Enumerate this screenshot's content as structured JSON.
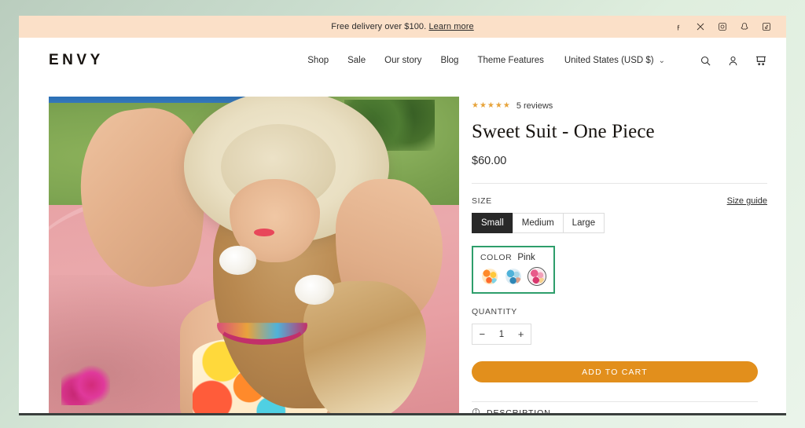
{
  "announcement": {
    "text": "Free delivery over $100.",
    "link_label": "Learn more",
    "socials": [
      {
        "name": "facebook-icon",
        "label": "Facebook"
      },
      {
        "name": "x-twitter-icon",
        "label": "X"
      },
      {
        "name": "instagram-icon",
        "label": "Instagram"
      },
      {
        "name": "snapchat-icon",
        "label": "Snapchat"
      },
      {
        "name": "tiktok-icon",
        "label": "TikTok"
      }
    ]
  },
  "header": {
    "logo": "ENVY",
    "nav": [
      {
        "label": "Shop"
      },
      {
        "label": "Sale"
      },
      {
        "label": "Our story"
      },
      {
        "label": "Blog"
      },
      {
        "label": "Theme Features"
      }
    ],
    "locale": "United States (USD $)",
    "locale_caret": "⌄",
    "icons": [
      {
        "name": "search-icon"
      },
      {
        "name": "account-icon"
      },
      {
        "name": "cart-icon"
      }
    ]
  },
  "product": {
    "stars": "★★★★★",
    "rating_value": 5,
    "reviews_label": "5 reviews",
    "title": "Sweet Suit - One Piece",
    "price": "$60.00",
    "size": {
      "label": "SIZE",
      "guide_label": "Size guide",
      "options": [
        {
          "label": "Small",
          "selected": true
        },
        {
          "label": "Medium",
          "selected": false
        },
        {
          "label": "Large",
          "selected": false
        }
      ]
    },
    "color": {
      "label": "COLOR",
      "value": "Pink",
      "highlighted": true,
      "highlight_color": "#2e9e6b",
      "options": [
        {
          "name": "swatch-orange",
          "label": "Orange",
          "selected": false
        },
        {
          "name": "swatch-blue",
          "label": "Blue",
          "selected": false
        },
        {
          "name": "swatch-pink",
          "label": "Pink",
          "selected": true
        }
      ]
    },
    "quantity": {
      "label": "QUANTITY",
      "value": "1",
      "decrease": "−",
      "increase": "+"
    },
    "add_to_cart": "ADD TO CART",
    "accent_color": "#e28f1c",
    "accordion": {
      "title": "DESCRIPTION",
      "chevron": "⌄",
      "expanded": false
    },
    "image_alt": "Woman in wide-brim straw hat and floral one-piece swimsuit by a pink pool"
  }
}
